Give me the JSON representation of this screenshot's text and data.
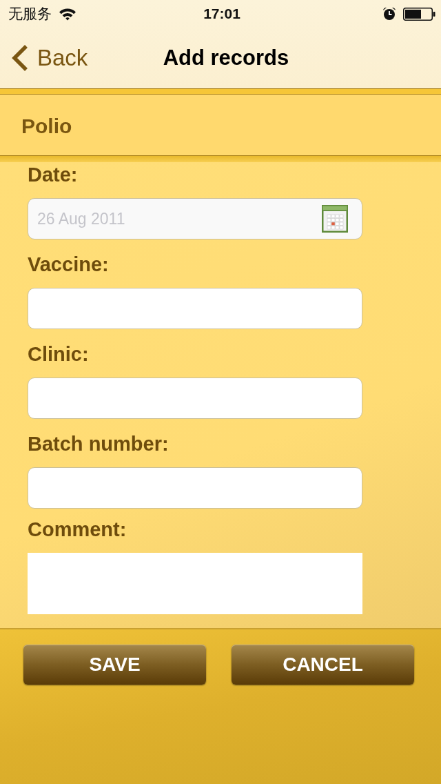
{
  "status_bar": {
    "carrier": "无服务",
    "time": "17:01"
  },
  "nav_bar": {
    "back": "Back",
    "title": "Add records"
  },
  "section": {
    "title": "Polio"
  },
  "fields": [
    {
      "kind": "date",
      "label": "Date:",
      "placeholder": "26 Aug 2011"
    },
    {
      "kind": "text",
      "label": "Vaccine:"
    },
    {
      "kind": "text",
      "label": "Clinic:"
    },
    {
      "kind": "text",
      "label": "Batch number:"
    },
    {
      "kind": "textarea",
      "label": "Comment:"
    }
  ],
  "buttons": [
    "SAVE",
    "CANCEL"
  ]
}
